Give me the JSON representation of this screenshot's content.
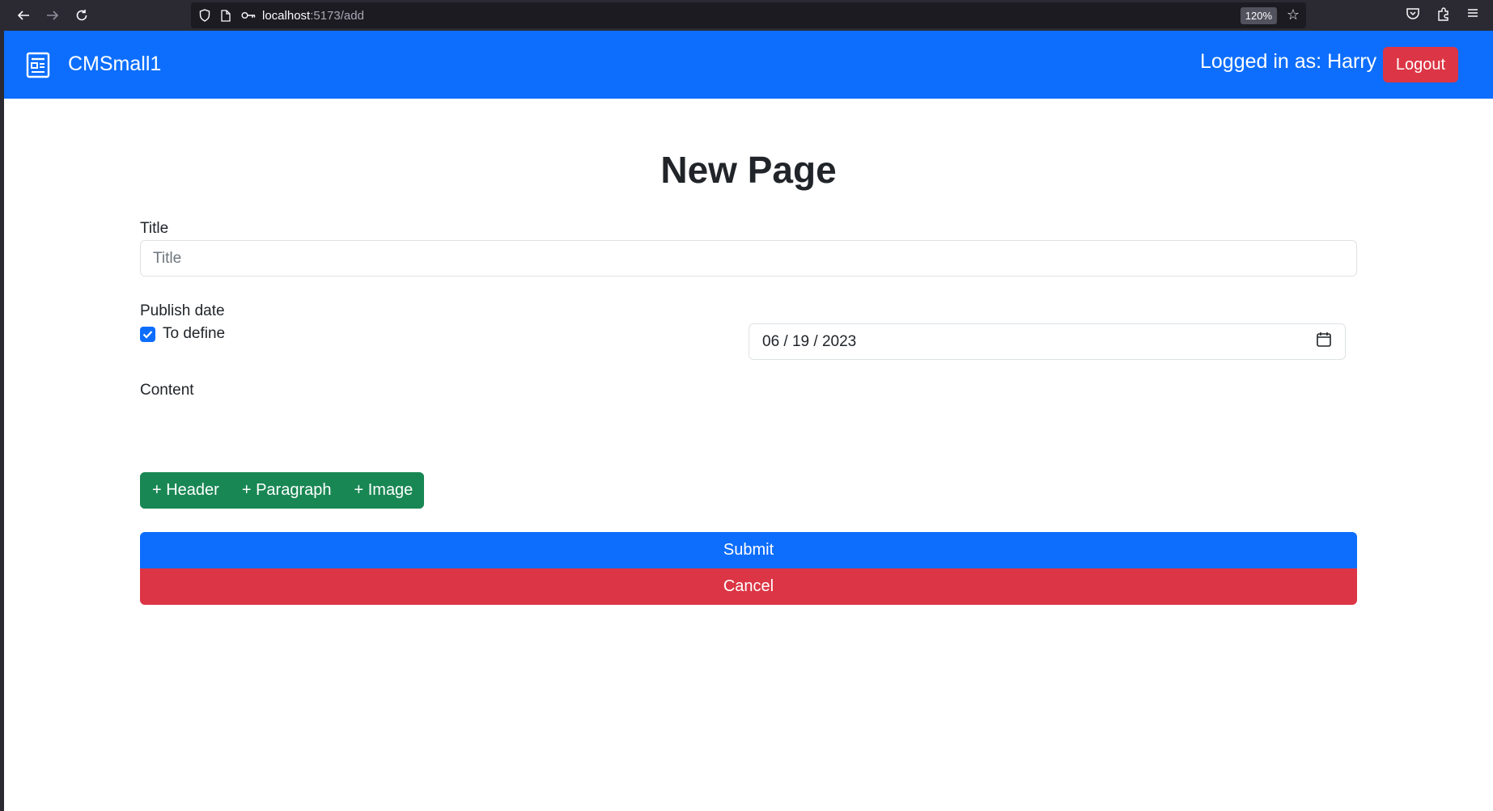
{
  "browser": {
    "url_host": "localhost",
    "url_rest": ":5173/add",
    "zoom": "120%"
  },
  "navbar": {
    "brand": "CMSmall1",
    "user_label": "Logged in as: Harry",
    "logout_label": "Logout"
  },
  "form": {
    "heading": "New Page",
    "title_label": "Title",
    "title_placeholder": "Title",
    "title_value": "",
    "publish_label": "Publish date",
    "to_define_label": "To define",
    "to_define_checked": true,
    "date_value": "06 / 19 / 2023",
    "content_label": "Content",
    "add_buttons": [
      "+ Header",
      "+ Paragraph",
      "+ Image"
    ],
    "submit_label": "Submit",
    "cancel_label": "Cancel"
  },
  "colors": {
    "primary": "#0d6efd",
    "danger": "#dc3545",
    "success": "#198754"
  }
}
